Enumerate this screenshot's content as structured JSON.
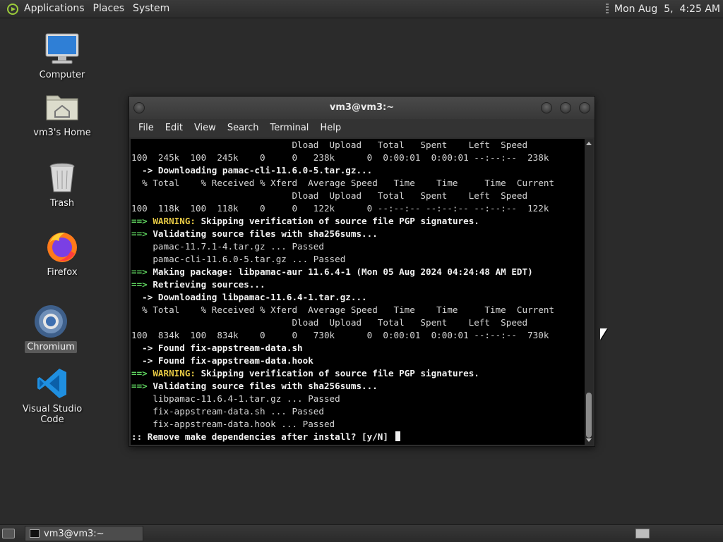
{
  "top_panel": {
    "menus": [
      "Applications",
      "Places",
      "System"
    ],
    "clock": "Mon Aug  5,  4:25 AM"
  },
  "desktop": {
    "icons": [
      {
        "label": "Computer",
        "icon": "computer-icon"
      },
      {
        "label": "vm3's Home",
        "icon": "home-folder-icon"
      },
      {
        "label": "Trash",
        "icon": "trash-icon"
      },
      {
        "label": "Firefox",
        "icon": "firefox-icon"
      },
      {
        "label": "Chromium",
        "icon": "chromium-icon",
        "selected": true
      },
      {
        "label": "Visual Studio Code",
        "icon": "vscode-icon"
      }
    ]
  },
  "terminal_window": {
    "title": "vm3@vm3:~",
    "menus": [
      "File",
      "Edit",
      "View",
      "Search",
      "Terminal",
      "Help"
    ],
    "lines": [
      "                              Dload  Upload   Total   Spent    Left  Speed",
      "100  245k  100  245k    0     0   238k      0  0:00:01  0:00:01 --:--:--  238k",
      "  -> Downloading pamac-cli-11.6.0-5.tar.gz...",
      "  % Total    % Received % Xferd  Average Speed   Time    Time     Time  Current",
      "                              Dload  Upload   Total   Spent    Left  Speed",
      "100  118k  100  118k    0     0   122k      0 --:--:-- --:--:-- --:--:--  122k",
      "==> WARNING: Skipping verification of source file PGP signatures.",
      "==> Validating source files with sha256sums...",
      "    pamac-11.7.1-4.tar.gz ... Passed",
      "    pamac-cli-11.6.0-5.tar.gz ... Passed",
      "==> Making package: libpamac-aur 11.6.4-1 (Mon 05 Aug 2024 04:24:48 AM EDT)",
      "==> Retrieving sources...",
      "  -> Downloading libpamac-11.6.4-1.tar.gz...",
      "  % Total    % Received % Xferd  Average Speed   Time    Time     Time  Current",
      "                              Dload  Upload   Total   Spent    Left  Speed",
      "100  834k  100  834k    0     0   730k      0  0:00:01  0:00:01 --:--:--  730k",
      "  -> Found fix-appstream-data.sh",
      "  -> Found fix-appstream-data.hook",
      "==> WARNING: Skipping verification of source file PGP signatures.",
      "==> Validating source files with sha256sums...",
      "    libpamac-11.6.4-1.tar.gz ... Passed",
      "    fix-appstream-data.sh ... Passed",
      "    fix-appstream-data.hook ... Passed",
      ":: Remove make dependencies after install? [y/N] "
    ]
  },
  "bottom_panel": {
    "task_label": "vm3@vm3:~"
  }
}
